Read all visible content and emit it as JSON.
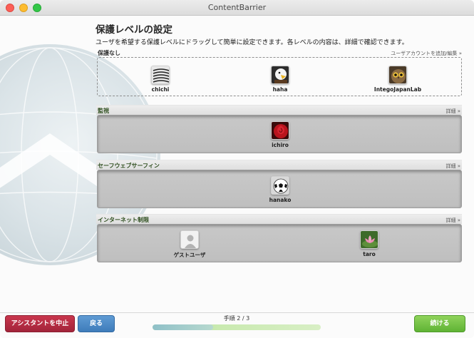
{
  "window": {
    "title": "ContentBarrier"
  },
  "heading": "保護レベルの設定",
  "description": "ユーザを希望する保護レベルにドラッグして簡単に設定できます。各レベルの内容は、詳細で確認できます。",
  "unprotected": {
    "label": "保護なし",
    "link": "ユーザアカウントを追加/編集 »",
    "users": [
      {
        "name": "chichi",
        "icon": "zebra-icon"
      },
      {
        "name": "haha",
        "icon": "eagle-icon"
      },
      {
        "name": "IntegoJapanLab",
        "icon": "owl-icon"
      }
    ]
  },
  "levels": [
    {
      "label": "監視",
      "link": "詳細 »",
      "users": [
        {
          "name": "ichiro",
          "icon": "rose-icon"
        }
      ]
    },
    {
      "label": "セーフウェブサーフィン",
      "link": "詳細 »",
      "users": [
        {
          "name": "hanako",
          "icon": "soccer-ball-icon"
        }
      ]
    },
    {
      "label": "インターネット制限",
      "link": "詳細 »",
      "users": [
        {
          "name": "ゲストユーザ",
          "icon": "guest-silhouette-icon"
        },
        {
          "name": "taro",
          "icon": "lotus-icon"
        }
      ]
    }
  ],
  "footer": {
    "stop_label": "アシスタントを中止",
    "back_label": "戻る",
    "next_label": "続ける",
    "step_text": "手順 2 / 3",
    "progress_fraction": 0.36
  },
  "colors": {
    "stop": "#b32c43",
    "back": "#4d8ac6",
    "next": "#74c446",
    "progress_fill": "#9ec9cb",
    "progress_track": "#c9eab0"
  }
}
